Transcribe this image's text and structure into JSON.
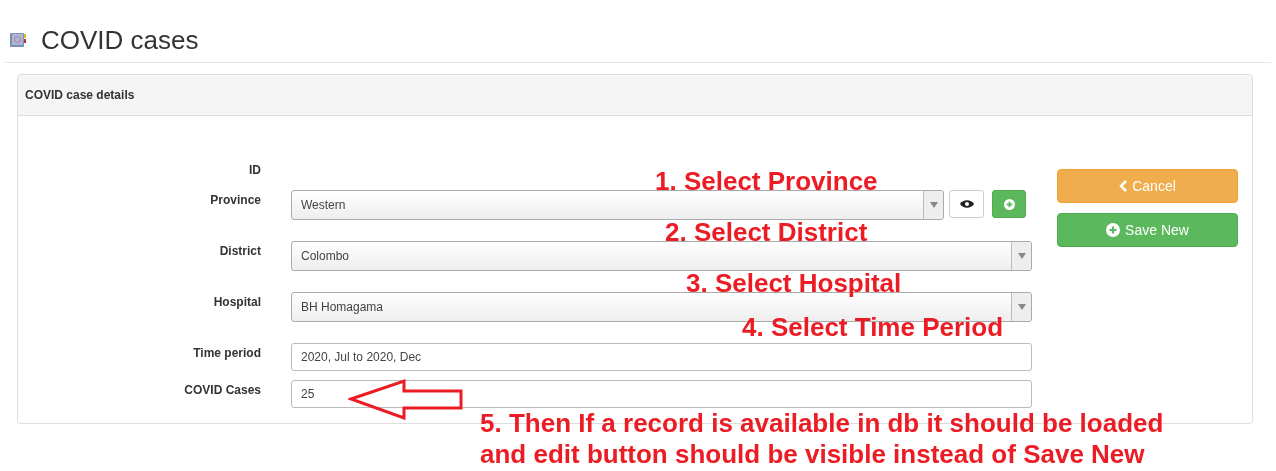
{
  "page": {
    "title": "COVID cases"
  },
  "panel": {
    "title": "COVID case details",
    "fields": [
      {
        "label": "ID",
        "kind": "static"
      },
      {
        "label": "Province",
        "kind": "select_actions",
        "value": "Western"
      },
      {
        "label": "District",
        "kind": "select",
        "value": "Colombo"
      },
      {
        "label": "Hospital",
        "kind": "select",
        "value": "BH Homagama"
      },
      {
        "label": "Time period",
        "kind": "input",
        "value": "2020, Jul to 2020, Dec"
      },
      {
        "label": "COVID Cases",
        "kind": "input",
        "value": "25"
      }
    ],
    "buttons": [
      {
        "label": "Cancel",
        "kind": "cancel"
      },
      {
        "label": "Save New",
        "kind": "save"
      }
    ]
  },
  "annotations": [
    {
      "lines": [
        "1. Select Province"
      ]
    },
    {
      "lines": [
        "2. Select District"
      ]
    },
    {
      "lines": [
        "3. Select Hospital"
      ]
    },
    {
      "lines": [
        "4. Select Time Period"
      ]
    },
    {
      "lines": [
        "5. Then If a record is available in db it should be loaded",
        "and edit button should be visible instead of Save New"
      ]
    }
  ]
}
